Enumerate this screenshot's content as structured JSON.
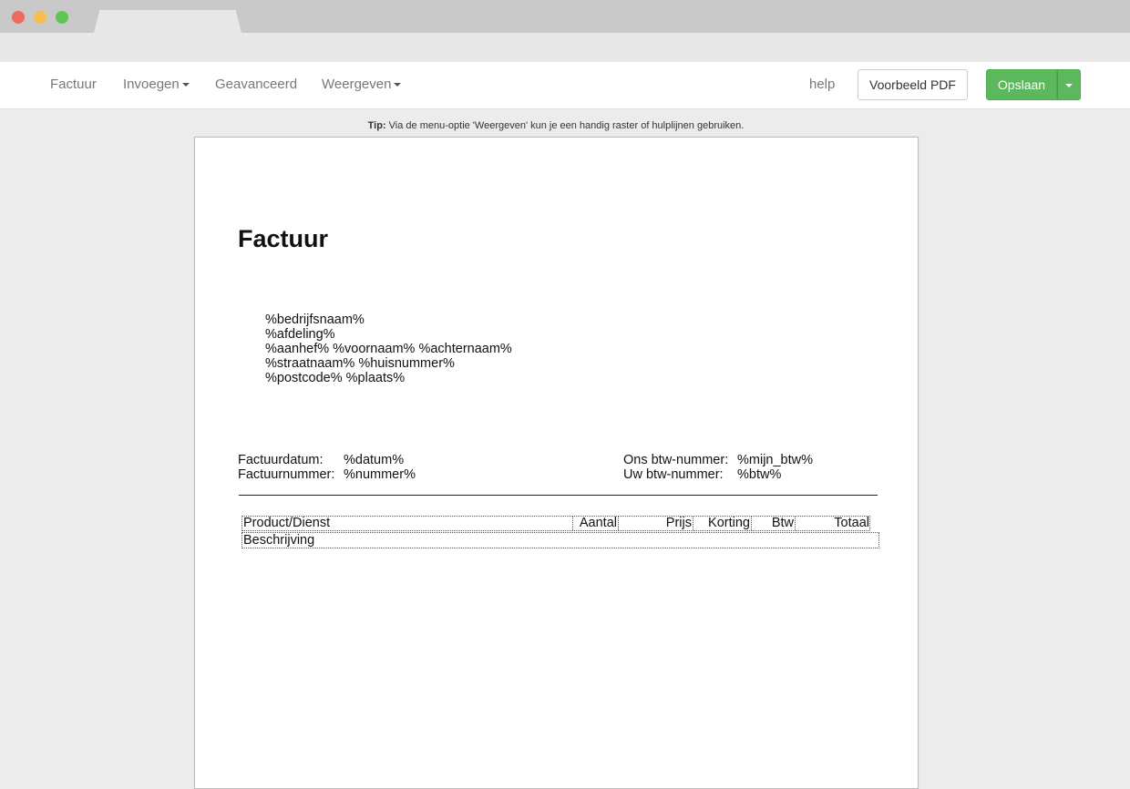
{
  "navbar": {
    "factuur": "Factuur",
    "invoegen": "Invoegen",
    "geavanceerd": "Geavanceerd",
    "weergeven": "Weergeven",
    "help": "help",
    "preview_label": "Voorbeeld PDF",
    "save_label": "Opslaan"
  },
  "colors": {
    "save_button": "#5cb85c",
    "page_background": "#ececec"
  },
  "tip": {
    "prefix": "Tip:",
    "text": "Via de menu-optie 'Weergeven' kun je een handig raster of hulplijnen gebruiken."
  },
  "document": {
    "title": "Factuur",
    "address": [
      "%bedrijfsnaam%",
      "%afdeling%",
      "%aanhef% %voornaam% %achternaam%",
      "%straatnaam% %huisnummer%",
      "%postcode% %plaats%"
    ],
    "meta_left": [
      {
        "label": "Factuurdatum:",
        "value": "%datum%"
      },
      {
        "label": "Factuurnummer:",
        "value": "%nummer%"
      }
    ],
    "meta_right": [
      {
        "label": "Ons btw-nummer:",
        "value": "%mijn_btw%"
      },
      {
        "label": "Uw btw-nummer:",
        "value": "%btw%"
      }
    ],
    "table": {
      "columns": [
        "Product/Dienst",
        "Aantal",
        "Prijs",
        "Korting",
        "Btw",
        "Totaal"
      ],
      "description_row": "Beschrijving"
    }
  }
}
